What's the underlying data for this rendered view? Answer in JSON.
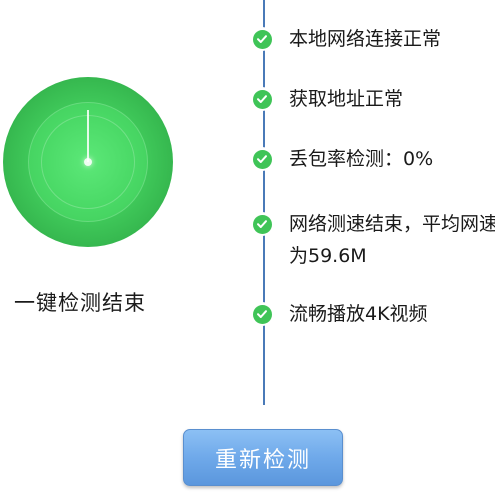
{
  "status": {
    "label": "一键检测结束",
    "accent_color": "#43cf5e"
  },
  "steps": [
    {
      "text": "本地网络连接正常",
      "icon": "check-circle-icon",
      "state": "done"
    },
    {
      "text": "获取地址正常",
      "icon": "check-circle-icon",
      "state": "done"
    },
    {
      "text": "丢包率检测：0%",
      "icon": "check-circle-icon",
      "state": "done"
    },
    {
      "text": "网络测速结束，平均网速为59.6M",
      "icon": "check-circle-icon",
      "state": "done"
    },
    {
      "text": "流畅播放4K视频",
      "icon": "check-circle-icon",
      "state": "done"
    }
  ],
  "actions": {
    "retest_label": "重新检测",
    "button_color": "#6fa9ea"
  },
  "timeline_color": "#4a7ab8"
}
